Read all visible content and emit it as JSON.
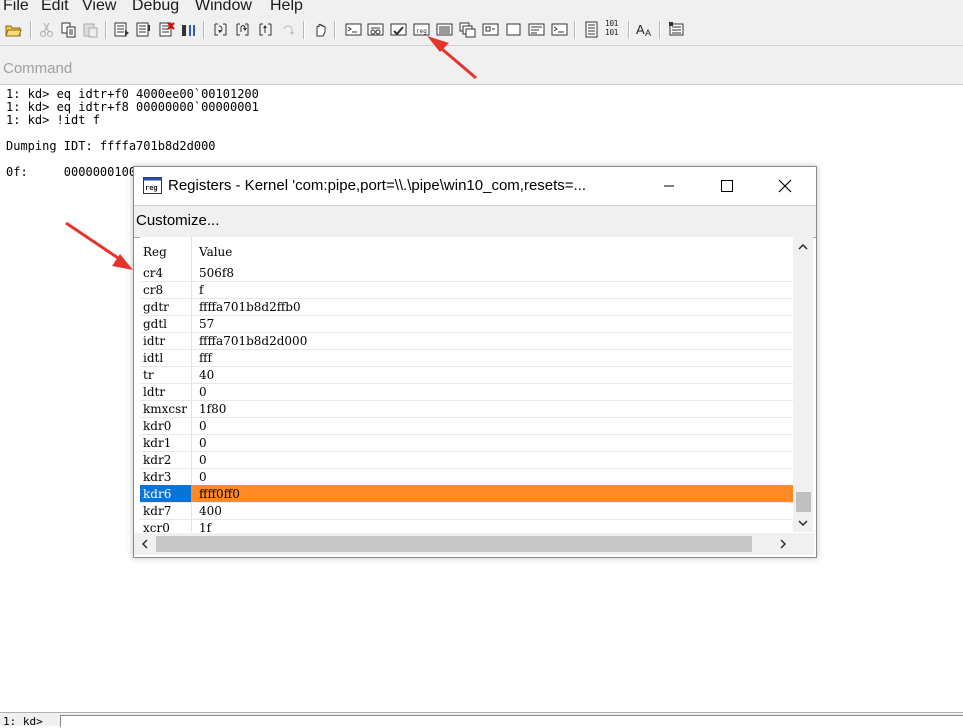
{
  "menu": {
    "items": [
      "File",
      "Edit",
      "View",
      "Debug",
      "Window",
      "Help"
    ]
  },
  "toolbar": {
    "binary_icon_text": [
      "101",
      "101"
    ],
    "font_icon_text": "AA",
    "icons": [
      "open-icon",
      "cut-icon",
      "copy-icon",
      "paste-icon",
      "go-icon",
      "restart-icon",
      "stop-debugging-icon",
      "break-icon",
      "step-into-icon",
      "step-over-icon",
      "step-out-icon",
      "run-to-cursor-icon",
      "source-mode-icon",
      "command-window-icon",
      "watch-window-icon",
      "locals-window-icon",
      "registers-window-icon",
      "memory-window-icon",
      "call-stack-icon",
      "disassembly-icon",
      "scratch-pad-icon",
      "processes-threads-icon",
      "source-mode-toggle-icon",
      "hex-display-icon",
      "font-icon",
      "options-icon"
    ]
  },
  "command": {
    "title": "Command",
    "lines": [
      "1: kd> eq idtr+f0 4000ee00`00101200",
      "1: kd> eq idtr+f8 00000000`00000001",
      "1: kd> !idt f",
      "",
      "Dumping IDT: ffffa701b8d2d000",
      "",
      "0f:     0000000100101200"
    ],
    "prompt": "1: kd>"
  },
  "registers_window": {
    "title": "Registers - Kernel 'com:pipe,port=\\\\.\\pipe\\win10_com,resets=...",
    "icon_text": "reg",
    "customize_label": "Customize...",
    "columns": {
      "reg": "Reg",
      "value": "Value"
    },
    "rows": [
      {
        "reg": "cr4",
        "value": "506f8"
      },
      {
        "reg": "cr8",
        "value": "f"
      },
      {
        "reg": "gdtr",
        "value": "ffffa701b8d2ffb0"
      },
      {
        "reg": "gdtl",
        "value": "57"
      },
      {
        "reg": "idtr",
        "value": "ffffa701b8d2d000"
      },
      {
        "reg": "idtl",
        "value": "fff"
      },
      {
        "reg": "tr",
        "value": "40"
      },
      {
        "reg": "ldtr",
        "value": "0"
      },
      {
        "reg": "kmxcsr",
        "value": "1f80"
      },
      {
        "reg": "kdr0",
        "value": "0"
      },
      {
        "reg": "kdr1",
        "value": "0"
      },
      {
        "reg": "kdr2",
        "value": "0"
      },
      {
        "reg": "kdr3",
        "value": "0"
      },
      {
        "reg": "kdr6",
        "value": "ffff0ff0"
      },
      {
        "reg": "kdr7",
        "value": "400"
      },
      {
        "reg": "xcr0",
        "value": "1f"
      }
    ],
    "selected_row_index": 13,
    "selection_colors": {
      "reg_cell": "#0a74d6",
      "value_cell": "#ff8a26"
    }
  },
  "annotations": {
    "arrow_color": "#e8322c"
  }
}
